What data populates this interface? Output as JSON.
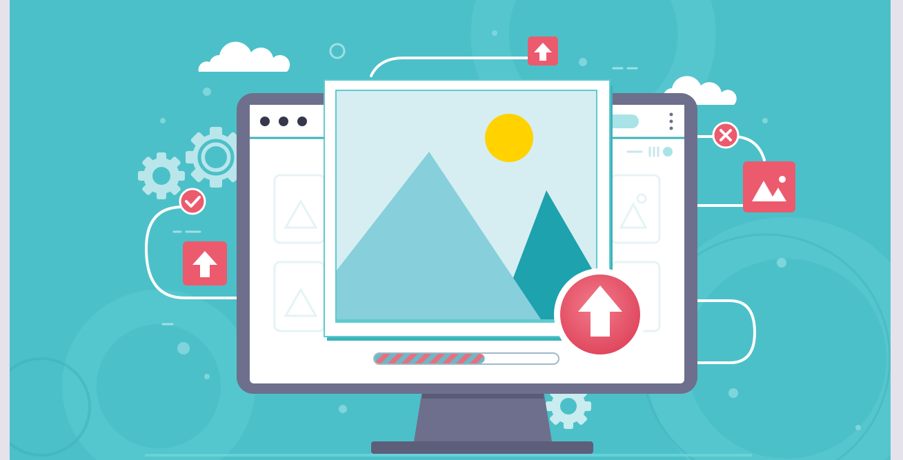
{
  "illustration": {
    "topic": "image upload",
    "upload_progress": 0.6,
    "colors": {
      "frame": "#e6e2ec",
      "background": "#4cc0c8",
      "monitor_bezel": "#6e6f8c",
      "screen": "#ffffff",
      "accent": "#ec5a6e",
      "sun": "#ffd200",
      "mountain_light": "#86cfdb",
      "mountain_dark": "#1ea2ad",
      "photo_sky": "#d6eef2"
    },
    "icons": [
      "cloud-icon",
      "gear-icon",
      "checkmark-icon",
      "upload-arrow-icon",
      "close-icon",
      "image-icon",
      "sun-icon",
      "mountain-icon"
    ]
  }
}
